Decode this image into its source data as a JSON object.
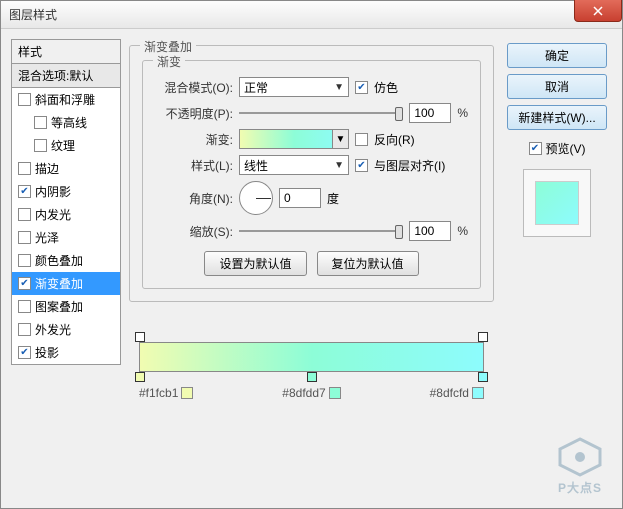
{
  "window": {
    "title": "图层样式"
  },
  "left": {
    "head": "样式",
    "sub": "混合选项:默认",
    "items": [
      {
        "label": "斜面和浮雕",
        "checked": false,
        "indent": false
      },
      {
        "label": "等高线",
        "checked": false,
        "indent": true
      },
      {
        "label": "纹理",
        "checked": false,
        "indent": true
      },
      {
        "label": "描边",
        "checked": false,
        "indent": false
      },
      {
        "label": "内阴影",
        "checked": true,
        "indent": false
      },
      {
        "label": "内发光",
        "checked": false,
        "indent": false
      },
      {
        "label": "光泽",
        "checked": false,
        "indent": false
      },
      {
        "label": "颜色叠加",
        "checked": false,
        "indent": false
      },
      {
        "label": "渐变叠加",
        "checked": true,
        "indent": false,
        "selected": true
      },
      {
        "label": "图案叠加",
        "checked": false,
        "indent": false
      },
      {
        "label": "外发光",
        "checked": false,
        "indent": false
      },
      {
        "label": "投影",
        "checked": true,
        "indent": false
      }
    ]
  },
  "mid": {
    "outer_title": "渐变叠加",
    "inner_title": "渐变",
    "blend_label": "混合模式(O):",
    "blend_value": "正常",
    "dither_label": "仿色",
    "dither_checked": true,
    "opacity_label": "不透明度(P):",
    "opacity_value": "100",
    "pct": "%",
    "gradient_label": "渐变:",
    "reverse_label": "反向(R)",
    "reverse_checked": false,
    "style_label": "样式(L):",
    "style_value": "线性",
    "align_label": "与图层对齐(I)",
    "align_checked": true,
    "angle_label": "角度(N):",
    "angle_value": "0",
    "angle_unit": "度",
    "scale_label": "缩放(S):",
    "scale_value": "100",
    "set_default": "设置为默认值",
    "reset_default": "复位为默认值",
    "stops": [
      {
        "hex": "#f1fcb1",
        "pos": 0
      },
      {
        "hex": "#8dfdd7",
        "pos": 50
      },
      {
        "hex": "#8dfcfd",
        "pos": 100
      }
    ]
  },
  "right": {
    "ok": "确定",
    "cancel": "取消",
    "new_style": "新建样式(W)...",
    "preview_label": "预览(V)",
    "preview_checked": true
  },
  "watermark": "P大点S"
}
